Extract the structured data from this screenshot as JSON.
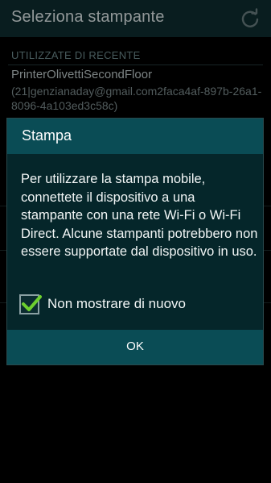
{
  "header": {
    "title": "Seleziona stampante",
    "refresh_icon": "refresh-icon"
  },
  "list": {
    "section_title": "UTILIZZATE DI RECENTE",
    "printers": [
      {
        "name": "PrinterOlivettiSecondFloor",
        "id": "(21|genzianaday@gmail.com2faca4af-897b-26a1-8096-4a103ed3c58c)"
      }
    ]
  },
  "dialog": {
    "title": "Stampa",
    "message": "Per utilizzare la stampa mobile, connettete il dispositivo a una stampante con una rete Wi-Fi o Wi-Fi Direct. Alcune stampanti potrebbero non essere supportate dal dispositivo in uso.",
    "checkbox": {
      "label": "Non mostrare di nuovo",
      "checked": true
    },
    "ok_label": "OK"
  },
  "colors": {
    "accent": "#0a4c55",
    "check": "#6dcf2f",
    "header_bg": "#0f2d30"
  }
}
